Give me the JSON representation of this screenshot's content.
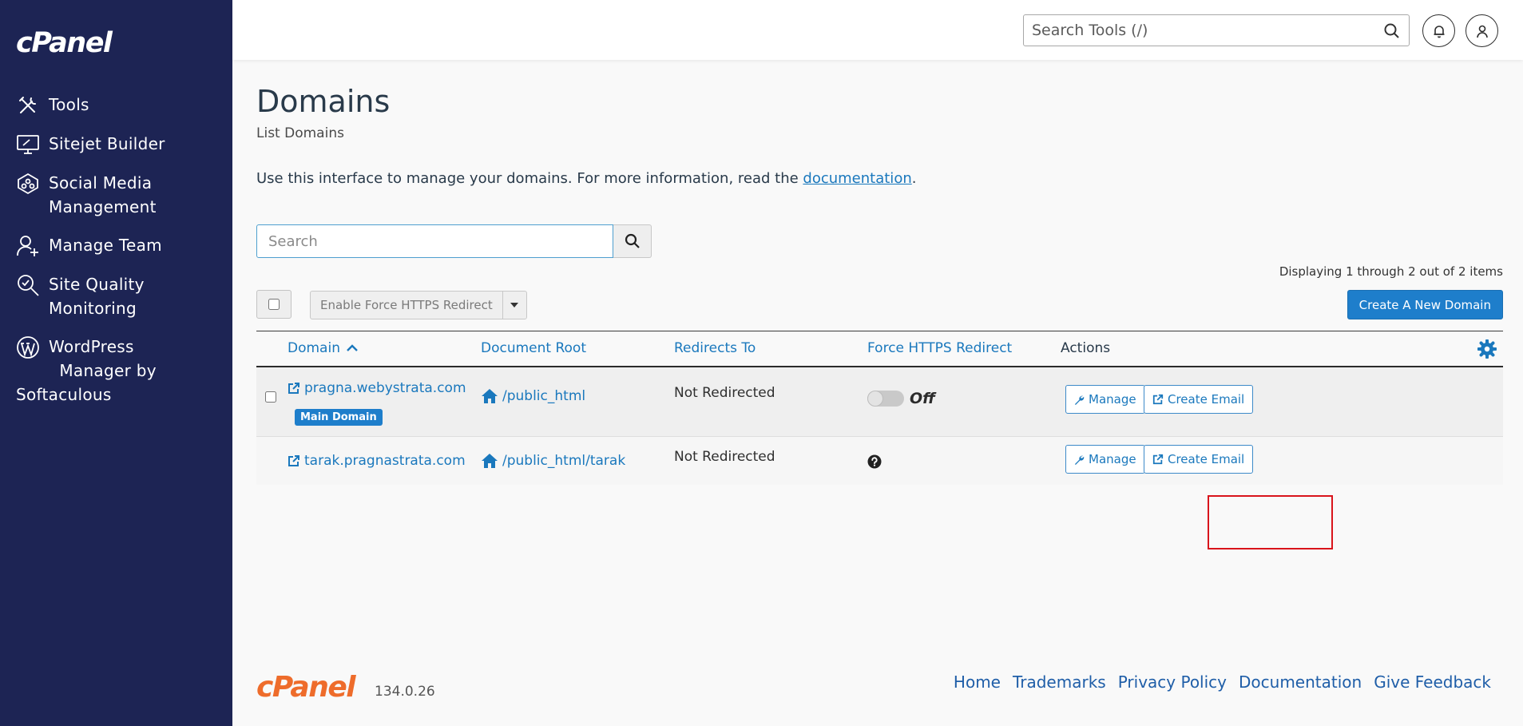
{
  "sidebar": {
    "logo": "cPanel",
    "items": [
      {
        "label": "Tools",
        "icon": "tools-icon"
      },
      {
        "label": "Sitejet Builder",
        "icon": "monitor-pen-icon"
      },
      {
        "label": "Social Media",
        "label2": "Management",
        "icon": "social-hub-icon"
      },
      {
        "label": "Manage Team",
        "icon": "user-add-icon"
      },
      {
        "label": "Site Quality",
        "label2": "Monitoring",
        "icon": "magnifier-check-icon"
      }
    ],
    "wordpress": {
      "line1": "WordPress",
      "line2": "Manager by",
      "line3": "Softaculous",
      "icon": "wordpress-icon"
    }
  },
  "header": {
    "search_placeholder": "Search Tools (/)"
  },
  "page": {
    "title": "Domains",
    "subtitle": "List Domains",
    "intro_text": "Use this interface to manage your domains. For more information, read the ",
    "intro_link": "documentation",
    "intro_end": ".",
    "search_placeholder": "Search",
    "display_count": "Displaying 1 through 2 out of 2 items",
    "force_https_button": "Enable Force HTTPS Redirect",
    "create_button": "Create A New Domain"
  },
  "table": {
    "columns": {
      "domain": "Domain",
      "docroot": "Document Root",
      "redirects": "Redirects To",
      "force": "Force HTTPS Redirect",
      "actions": "Actions"
    },
    "rows": [
      {
        "domain": "pragna.webystrata.com",
        "badge": "Main Domain",
        "docroot": "/public_html",
        "redirect": "Not Redirected",
        "force_state": "Off",
        "manage": "Manage",
        "create_email": "Create Email"
      },
      {
        "domain": "tarak.pragnastrata.com",
        "docroot": "/public_html/tarak",
        "redirect": "Not Redirected",
        "force_state": "",
        "manage": "Manage",
        "create_email": "Create Email"
      }
    ]
  },
  "footer": {
    "logo": "cPanel",
    "version": "134.0.26",
    "links": [
      "Home",
      "Trademarks",
      "Privacy Policy",
      "Documentation",
      "Give Feedback"
    ]
  },
  "colors": {
    "sidebar_bg": "#1d2454",
    "link": "#1a78bd",
    "primary_button": "#1e7ecb",
    "footer_logo": "#ee6c2b",
    "highlight": "#d9141b"
  }
}
